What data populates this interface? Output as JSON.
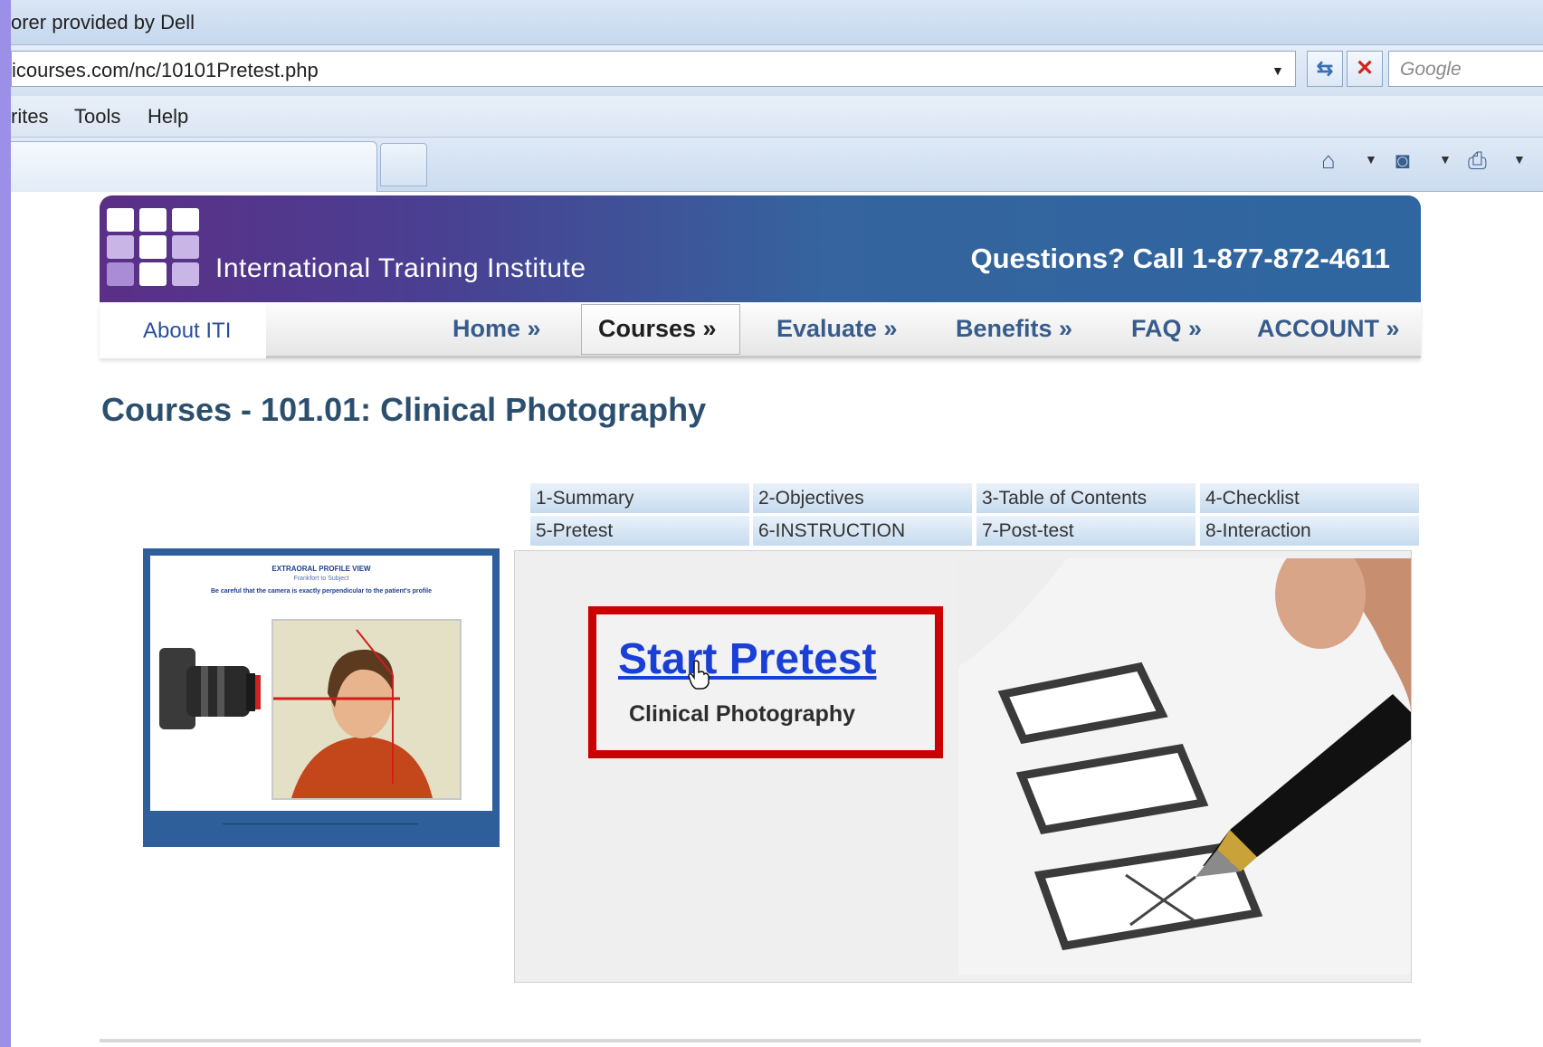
{
  "browser": {
    "title_text": "orer provided by Dell",
    "url": "icourses.com/nc/10101Pretest.php",
    "search_placeholder": "Google",
    "menu": [
      "rites",
      "Tools",
      "Help"
    ]
  },
  "site": {
    "name": "International Training Institute",
    "phone": "Questions? Call 1-877-872-4611",
    "logo_colors": [
      "#ffffff",
      "#c9b6e6",
      "#a98bd6"
    ]
  },
  "nav": {
    "about": "About ITI",
    "items": [
      "Home »",
      "Courses »",
      "Evaluate »",
      "Benefits »",
      "FAQ »",
      "ACCOUNT »"
    ],
    "active": "Courses »"
  },
  "heading": "Courses - 101.01: Clinical Photography",
  "course_tabs": [
    "1-Summary",
    "2-Objectives",
    "3-Table of Contents",
    "4-Checklist",
    "5-Pretest",
    "6-INSTRUCTION",
    "7-Post-test",
    "8-Interaction"
  ],
  "thumbnail": {
    "title": "EXTRAORAL PROFILE VIEW",
    "subtitle": "Frankfort to Subject",
    "note": "Be careful that the camera is exactly perpendicular to the patient's profile"
  },
  "pretest": {
    "link_label": "Start Pretest",
    "course_name": "Clinical Photography"
  },
  "colors": {
    "highlight": "#cc0000",
    "link": "#1a3fd6",
    "nav_text": "#375c8c",
    "heading": "#2c4f6e"
  }
}
